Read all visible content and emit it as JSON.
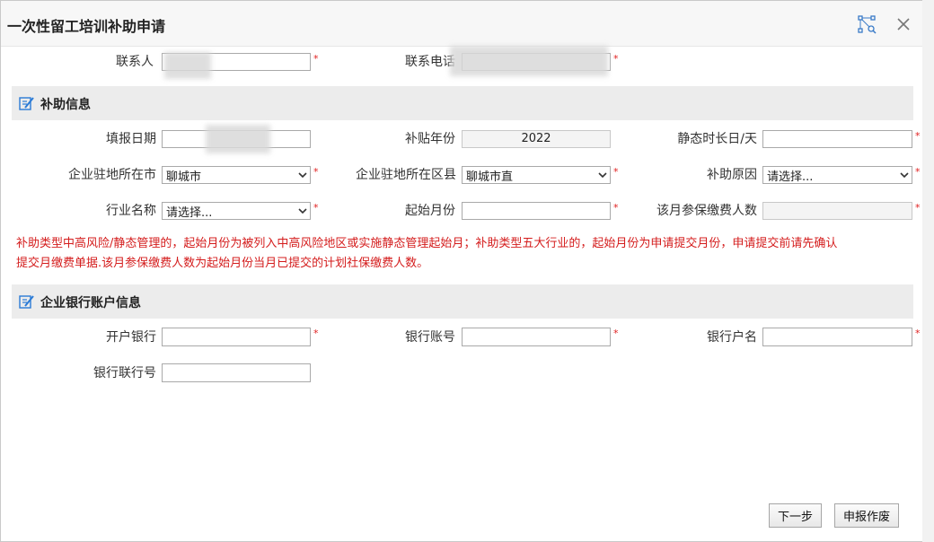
{
  "dialog": {
    "title": "一次性留工培训补助申请"
  },
  "contact": {
    "person_label": "联系人",
    "phone_label": "联系电话",
    "person_value": "",
    "phone_value": ""
  },
  "subsidy_section": {
    "title": "补助信息",
    "fill_date_label": "填报日期",
    "fill_date_value": "",
    "year_label": "补贴年份",
    "year_value": "2022",
    "static_days_label": "静态时长日/天",
    "static_days_value": "",
    "city_label": "企业驻地所在市",
    "city_value": "聊城市",
    "district_label": "企业驻地所在区县",
    "district_value": "聊城市直",
    "reason_label": "补助原因",
    "reason_value": "请选择...",
    "industry_label": "行业名称",
    "industry_value": "请选择...",
    "start_month_label": "起始月份",
    "start_month_value": "",
    "insured_label": "该月参保缴费人数",
    "insured_value": ""
  },
  "notice": {
    "line1": "补助类型中高风险/静态管理的，起始月份为被列入中高风险地区或实施静态管理起始月；补助类型五大行业的，起始月份为申请提交月份，申请提交前请先确认",
    "line2": "提交月缴费单据.该月参保缴费人数为起始月份当月已提交的计划社保缴费人数。"
  },
  "bank_section": {
    "title": "企业银行账户信息",
    "bank_label": "开户银行",
    "bank_value": "",
    "account_label": "银行账号",
    "account_value": "",
    "holder_label": "银行户名",
    "holder_value": "",
    "code_label": "银行联行号",
    "code_value": ""
  },
  "required_mark": "*",
  "buttons": {
    "next": "下一步",
    "void": "申报作废"
  },
  "colors": {
    "required": "#e02020",
    "notice": "#d41c1c",
    "section_bg": "#ececec",
    "icon_blue": "#2b7bd6"
  }
}
